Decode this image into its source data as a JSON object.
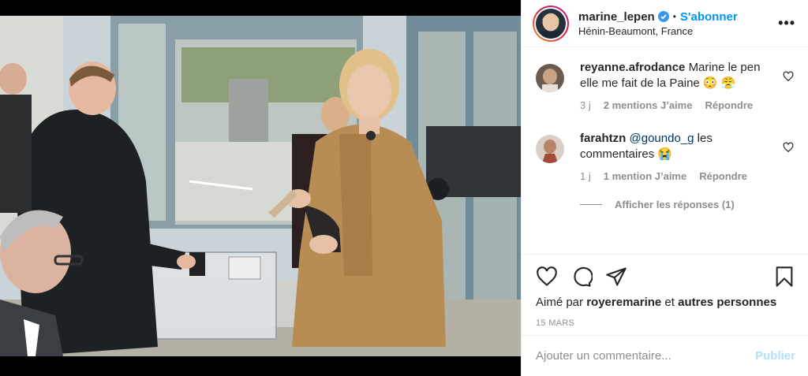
{
  "post": {
    "username": "marine_lepen",
    "follow_label": "S'abonner",
    "location": "Hénin-Beaumont, France",
    "separator": "•",
    "more_label": "•••"
  },
  "comments": [
    {
      "user": "reyanne.afrodance",
      "text": "Marine le pen elle me fait de la Paine 😳 😤",
      "time": "3 j",
      "likes": "2 mentions J’aime",
      "reply": "Répondre"
    },
    {
      "user": "farahtzn",
      "mention": "@goundo_g",
      "text": " les commentaires 😭",
      "time": "1 j",
      "likes": "1 mention J’aime",
      "reply": "Répondre"
    }
  ],
  "view_replies": "Afficher les réponses (1)",
  "liked_by": {
    "prefix": "Aimé par ",
    "user": "royeremarine",
    "middle": " et ",
    "others": "autres personnes"
  },
  "date": "15 MARS",
  "add_comment": {
    "placeholder": "Ajouter un commentaire...",
    "publish_label": "Publier"
  },
  "colors": {
    "accent": "#0095f6",
    "publish_disabled": "#b2dffc",
    "muted": "#8e8e8e"
  },
  "icons": [
    "verified-icon",
    "more-icon",
    "heart-icon",
    "comment-icon",
    "share-icon",
    "bookmark-icon"
  ]
}
